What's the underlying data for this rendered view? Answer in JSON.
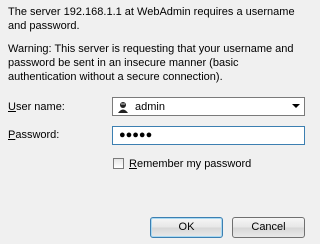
{
  "message": "The server 192.168.1.1 at WebAdmin requires a username and password.",
  "warning": "Warning: This server is requesting that your username and password be sent in an insecure manner (basic authentication without a secure connection).",
  "fields": {
    "username": {
      "label_accesskey": "U",
      "label_rest": "ser name:",
      "value": "admin",
      "icon": "user-icon"
    },
    "password": {
      "label_accesskey": "P",
      "label_rest": "assword:",
      "masked_value": "●●●●●"
    }
  },
  "remember": {
    "label_accesskey": "R",
    "label_rest": "emember my password",
    "checked": false
  },
  "buttons": {
    "ok": "OK",
    "cancel": "Cancel"
  }
}
